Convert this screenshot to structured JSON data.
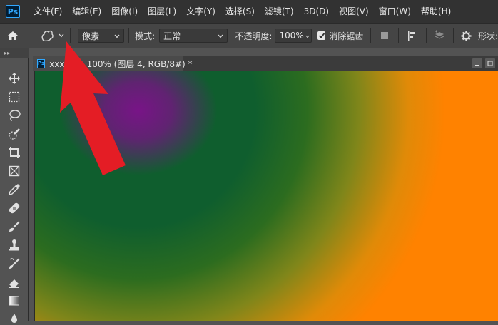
{
  "app": {
    "logo": "Ps"
  },
  "menu": [
    "文件(F)",
    "编辑(E)",
    "图像(I)",
    "图层(L)",
    "文字(Y)",
    "选择(S)",
    "滤镜(T)",
    "3D(D)",
    "视图(V)",
    "窗口(W)",
    "帮助(H)"
  ],
  "options": {
    "home_icon": "home-icon",
    "tool_icon": "custom-shape-tool-icon",
    "mode_select_value": "像素",
    "blend_label": "模式:",
    "blend_value": "正常",
    "opacity_label": "不透明度:",
    "opacity_value": "100%",
    "antialias_label": "消除锯齿",
    "antialias_checked": true,
    "shape_label": "形状:"
  },
  "tools_panel": {
    "collapse_glyph": "▸▸"
  },
  "document": {
    "tab_title": "xxx.   @ 100% (图层 4, RGB/8#) *",
    "icon": "Ps"
  },
  "colors": {
    "menubar": "#323232",
    "optionsbar": "#454545",
    "panel": "#535353",
    "canvas_purple": "#7a1487",
    "canvas_green": "#0f5e2e",
    "canvas_orange": "#ff8200",
    "arrow": "#e41d25"
  }
}
